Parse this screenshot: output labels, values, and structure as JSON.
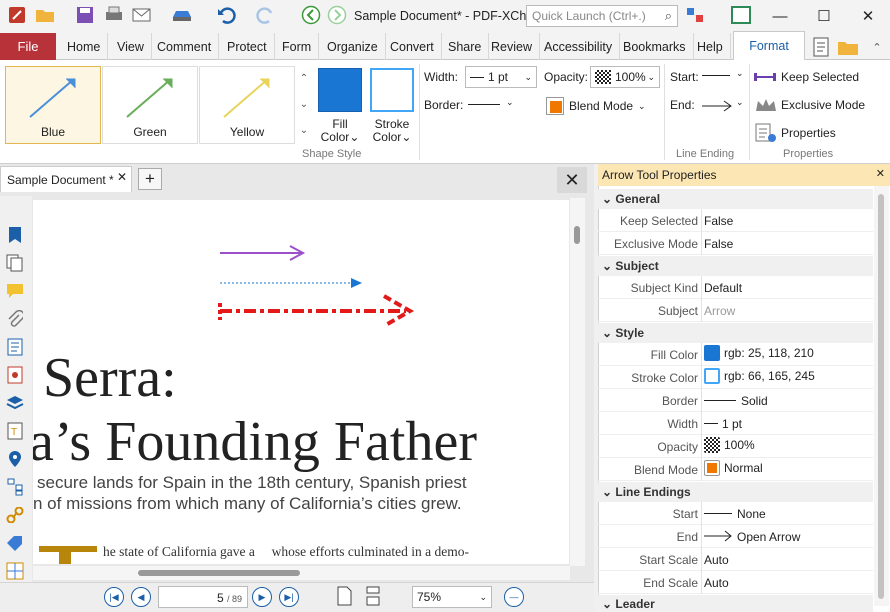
{
  "window": {
    "title": "Sample Document* - PDF-XCh..",
    "quick_launch_placeholder": "Quick Launch (Ctrl+.)"
  },
  "menu": {
    "file": "File",
    "tabs": [
      "Home",
      "View",
      "Comment",
      "Protect",
      "Form",
      "Organize",
      "Convert",
      "Share",
      "Review",
      "Accessibility",
      "Bookmarks",
      "Help",
      "Format"
    ]
  },
  "ribbon": {
    "presets": [
      {
        "label": "Blue",
        "color": "#4a90d9"
      },
      {
        "label": "Green",
        "color": "#6aae5c"
      },
      {
        "label": "Yellow",
        "color": "#e8d45a"
      }
    ],
    "fill_label": "Fill",
    "fill_sub": "Color",
    "stroke_label": "Stroke",
    "stroke_sub": "Color",
    "fill_color": "#1976d2",
    "stroke_color": "#42a5f5",
    "shape_style_group": "Shape Style",
    "width_label": "Width:",
    "width_value": "1 pt",
    "border_label": "Border:",
    "opacity_label": "Opacity:",
    "opacity_value": "100%",
    "blend_mode": "Blend Mode",
    "start_label": "Start:",
    "end_label": "End:",
    "line_ending_group": "Line Ending",
    "keep_selected": "Keep Selected",
    "exclusive_mode": "Exclusive Mode",
    "properties": "Properties",
    "properties_group": "Properties"
  },
  "document": {
    "tab_title": "Sample Document *",
    "heading1": "Serra:",
    "heading2": "a’s Founding Father",
    "sub1": "secure lands for Spain in the 18th century, Spanish priest",
    "sub2": "n of missions from which many of California’s cities grew.",
    "body": "he state of California gave a     whose efforts culminated in a demo-",
    "page_current": "5",
    "page_total": "/ 89",
    "zoom": "75%"
  },
  "panel": {
    "title": "Arrow Tool Properties",
    "sections": {
      "general": "General",
      "subject": "Subject",
      "style": "Style",
      "line_endings": "Line Endings",
      "leader": "Leader"
    },
    "rows": {
      "keep_selected": {
        "k": "Keep Selected",
        "v": "False"
      },
      "exclusive_mode": {
        "k": "Exclusive Mode",
        "v": "False"
      },
      "subject_kind": {
        "k": "Subject Kind",
        "v": "Default"
      },
      "subject": {
        "k": "Subject",
        "v": "Arrow"
      },
      "fill_color": {
        "k": "Fill Color",
        "v": "rgb: 25, 118, 210"
      },
      "stroke_color": {
        "k": "Stroke Color",
        "v": "rgb: 66, 165, 245"
      },
      "border": {
        "k": "Border",
        "v": "Solid"
      },
      "width": {
        "k": "Width",
        "v": "1 pt"
      },
      "opacity": {
        "k": "Opacity",
        "v": "100%"
      },
      "blend_mode": {
        "k": "Blend Mode",
        "v": "Normal"
      },
      "start": {
        "k": "Start",
        "v": "None"
      },
      "end": {
        "k": "End",
        "v": "Open Arrow"
      },
      "start_scale": {
        "k": "Start Scale",
        "v": "Auto"
      },
      "end_scale": {
        "k": "End Scale",
        "v": "Auto"
      }
    }
  }
}
